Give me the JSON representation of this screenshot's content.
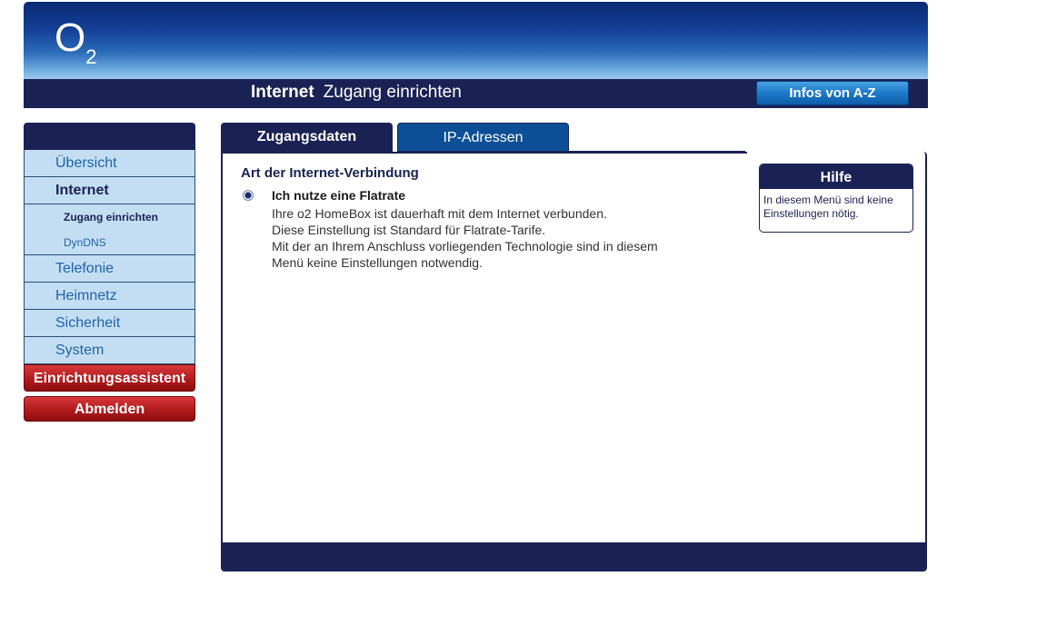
{
  "brand": {
    "logo_letter": "O",
    "logo_sub": "2"
  },
  "header": {
    "title_bold": "Internet",
    "title_rest": "Zugang einrichten",
    "infos_button": "Infos von A-Z"
  },
  "sidebar": {
    "items": [
      {
        "label": "Übersicht"
      },
      {
        "label": "Internet"
      },
      {
        "label": "Zugang einrichten"
      },
      {
        "label": "DynDNS"
      },
      {
        "label": "Telefonie"
      },
      {
        "label": "Heimnetz"
      },
      {
        "label": "Sicherheit"
      },
      {
        "label": "System"
      }
    ],
    "wizard": "Einrichtungsassistent",
    "logout": "Abmelden"
  },
  "tabs": [
    {
      "label": "Zugangsdaten",
      "active": true
    },
    {
      "label": "IP-Adressen",
      "active": false
    }
  ],
  "main": {
    "section_title": "Art der Internet-Verbindung",
    "option_label": "Ich nutze eine Flatrate",
    "option_selected": true,
    "description_lines": [
      "Ihre o2 HomeBox ist dauerhaft mit dem Internet verbunden.",
      "Diese Einstellung ist Standard für Flatrate-Tarife.",
      "Mit der an Ihrem Anschluss vorliegenden Technologie sind in diesem",
      "Menü keine Einstellungen notwendig."
    ]
  },
  "help": {
    "title": "Hilfe",
    "text": "In diesem Menü sind keine Einstellungen nötig."
  }
}
